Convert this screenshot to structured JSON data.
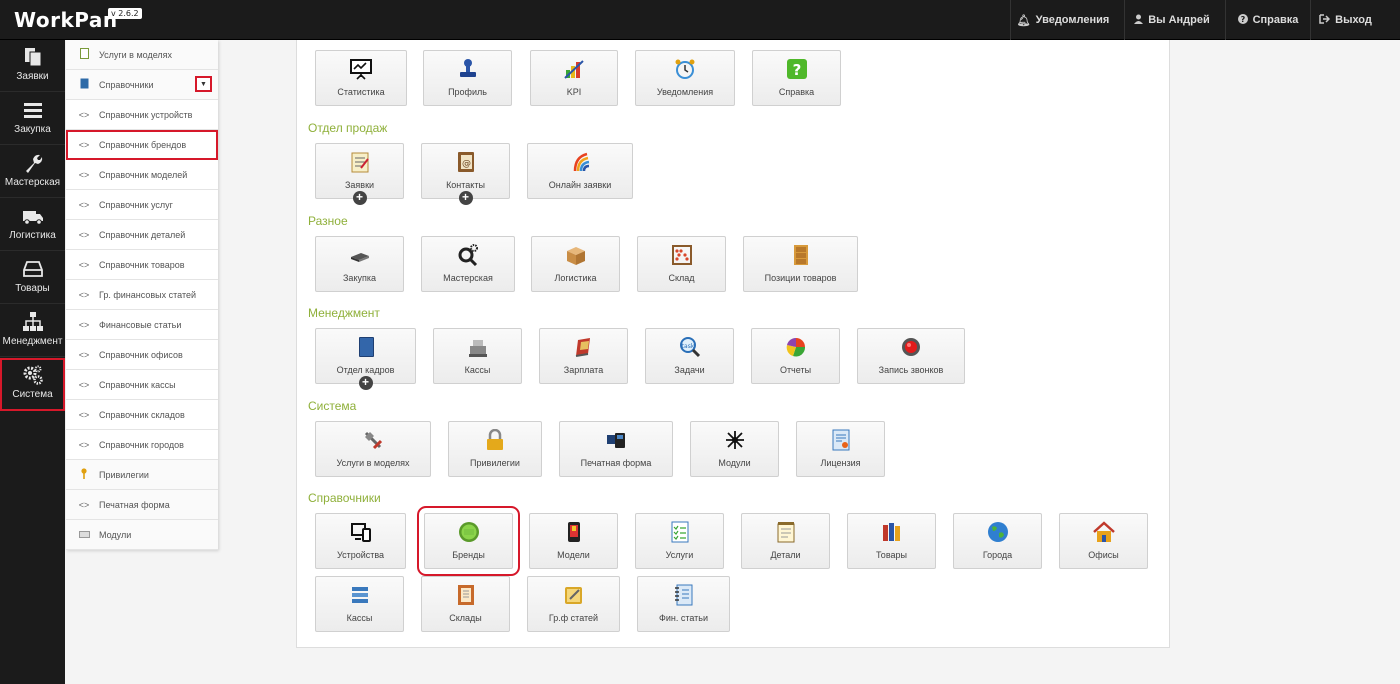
{
  "app": {
    "title": "WorkPan",
    "version": "v 2.6.2"
  },
  "topbar": {
    "notifications": "Уведомления",
    "user": "Вы Андрей",
    "help": "Справка",
    "logout": "Выход"
  },
  "sidebar": [
    {
      "label": "Заявки",
      "icon": "requests-icon"
    },
    {
      "label": "Закупка",
      "icon": "list-icon"
    },
    {
      "label": "Мастерская",
      "icon": "wrench-icon"
    },
    {
      "label": "Логистика",
      "icon": "truck-icon"
    },
    {
      "label": "Товары",
      "icon": "hdd-icon"
    },
    {
      "label": "Менеджмент",
      "icon": "org-chart-icon"
    },
    {
      "label": "Система",
      "icon": "gears-icon"
    }
  ],
  "submenu": [
    {
      "label": "Услуги в моделях"
    },
    {
      "label": "Справочники"
    },
    {
      "label": "Справочник устройств"
    },
    {
      "label": "Справочник брендов"
    },
    {
      "label": "Справочник моделей"
    },
    {
      "label": "Справочник услуг"
    },
    {
      "label": "Справочник деталей"
    },
    {
      "label": "Справочник товаров"
    },
    {
      "label": "Гр. финансовых статей"
    },
    {
      "label": "Финансовые статьи"
    },
    {
      "label": "Справочник офисов"
    },
    {
      "label": "Справочник кассы"
    },
    {
      "label": "Справочник складов"
    },
    {
      "label": "Справочник городов"
    },
    {
      "label": "Привилегии"
    },
    {
      "label": "Печатная форма"
    },
    {
      "label": "Модули"
    }
  ],
  "sections": {
    "sales": "Отдел продаж",
    "misc": "Разное",
    "management": "Менеджмент",
    "system": "Система",
    "directories": "Справочники"
  },
  "tiles": {
    "top": [
      "Статистика",
      "Профиль",
      "KPI",
      "Уведомления",
      "Справка"
    ],
    "sales": [
      "Заявки",
      "Контакты",
      "Онлайн заявки"
    ],
    "misc": [
      "Закупка",
      "Мастерская",
      "Логистика",
      "Склад",
      "Позиции товаров"
    ],
    "management": [
      "Отдел кадров",
      "Кассы",
      "Зарплата",
      "Задачи",
      "Отчеты",
      "Запись звонков"
    ],
    "system": [
      "Услуги в моделях",
      "Привилегии",
      "Печатная форма",
      "Модули",
      "Лицензия"
    ],
    "directories": [
      "Устройства",
      "Бренды",
      "Модели",
      "Услуги",
      "Детали",
      "Товары",
      "Города",
      "Офисы",
      "Кассы",
      "Склады",
      "Гр.ф статей",
      "Фин. статьи"
    ]
  },
  "colors": {
    "accent": "#8fb03a",
    "highlight": "#d6182a",
    "dark": "#1b1b1b"
  }
}
